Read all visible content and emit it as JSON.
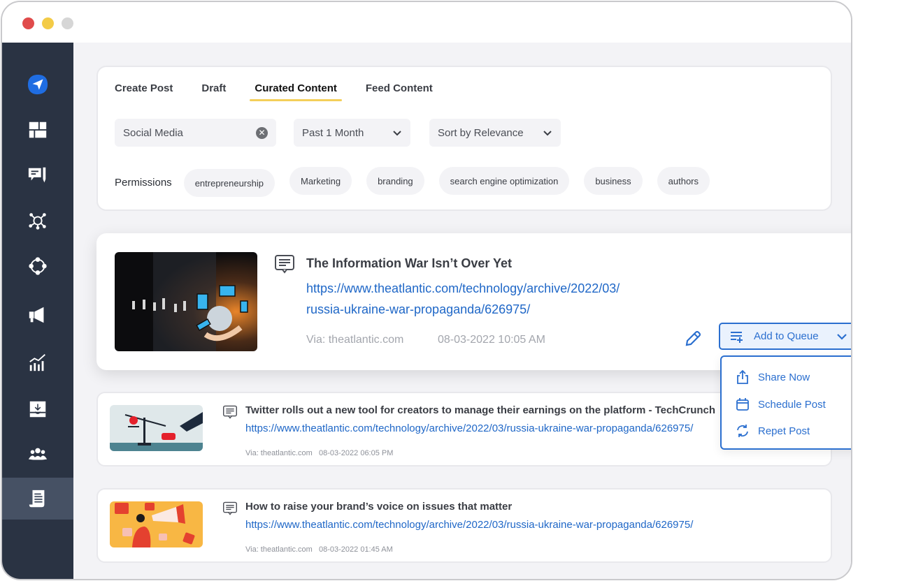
{
  "window": {
    "controls": [
      "close",
      "minimize",
      "maximize"
    ]
  },
  "sidebar": {
    "items": [
      {
        "name": "send-icon",
        "active": false
      },
      {
        "name": "dashboard-icon",
        "active": false
      },
      {
        "name": "compose-icon",
        "active": false
      },
      {
        "name": "network-icon",
        "active": false
      },
      {
        "name": "hub-icon",
        "active": false
      },
      {
        "name": "megaphone-icon",
        "active": false
      },
      {
        "name": "analytics-icon",
        "active": false
      },
      {
        "name": "inbox-icon",
        "active": false
      },
      {
        "name": "team-icon",
        "active": false
      },
      {
        "name": "content-icon",
        "active": true
      }
    ],
    "brand_color": "#1f6de2"
  },
  "tabs": [
    {
      "label": "Create Post",
      "active": false
    },
    {
      "label": "Draft",
      "active": false
    },
    {
      "label": "Curated Content",
      "active": true
    },
    {
      "label": "Feed Content",
      "active": false
    }
  ],
  "filters": {
    "search": {
      "value": "Social Media"
    },
    "time_range": {
      "value": "Past 1 Month"
    },
    "sort": {
      "value": "Sort by Relevance"
    }
  },
  "permissions": {
    "label": "Permissions",
    "chips": [
      "entrepreneurship",
      "Marketing",
      "branding",
      "search engine optimization",
      "business",
      "authors"
    ]
  },
  "posts": [
    {
      "title": "The Information War Isn’t Over Yet",
      "link_line1": "https://www.theatlantic.com/technology/archive/2022/03/",
      "link_line2": "russia-ukraine-war-propaganda/626975/",
      "via": "Via: theatlantic.com",
      "date": "08-03-2022 10:05 AM"
    },
    {
      "title": "Twitter rolls out a new tool for creators to manage their earnings on the platform - TechCrunch",
      "link": "https://www.theatlantic.com/technology/archive/2022/03/russia-ukraine-war-propaganda/626975/",
      "via": "Via: theatlantic.com",
      "date": "08-03-2022 06:05 PM"
    },
    {
      "title": "How to raise your brand’s voice on issues that matter",
      "link": "https://www.theatlantic.com/technology/archive/2022/03/russia-ukraine-war-propaganda/626975/",
      "via": "Via: theatlantic.com",
      "date": "08-03-2022 01:45 AM"
    }
  ],
  "queue": {
    "button_label": "Add to Queue",
    "menu": [
      {
        "label": "Share Now",
        "icon": "share-icon"
      },
      {
        "label": "Schedule Post",
        "icon": "calendar-icon"
      },
      {
        "label": "Repet Post",
        "icon": "repeat-icon"
      }
    ],
    "accent_color": "#2b6fcf"
  }
}
